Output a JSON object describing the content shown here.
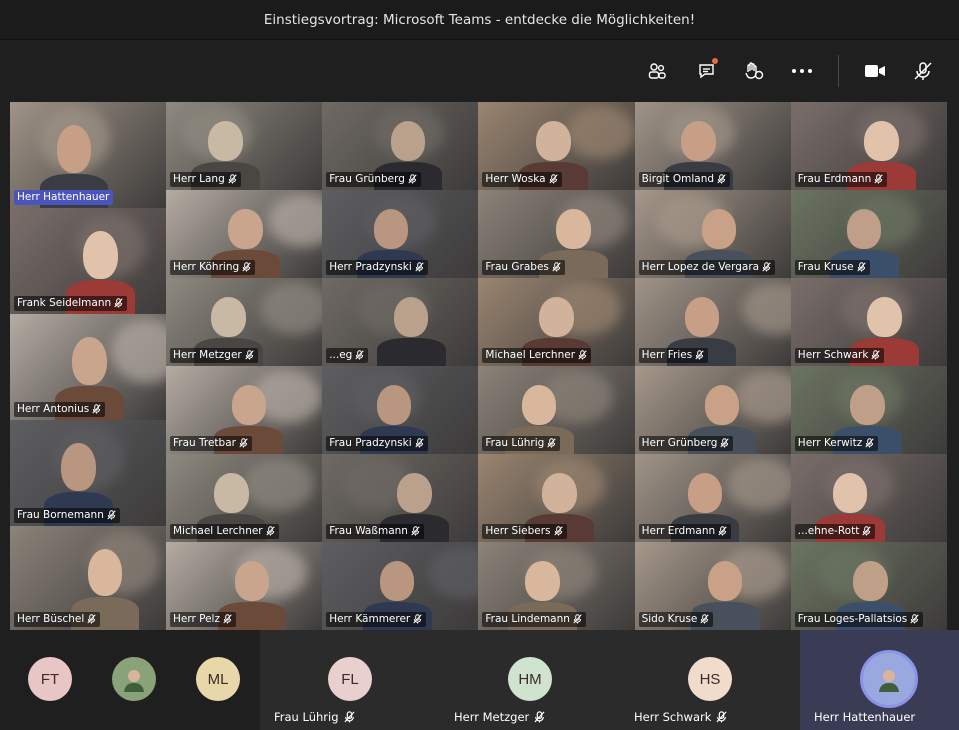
{
  "window": {
    "title": "Einstiegsvortrag: Microsoft Teams - entdecke die Möglichkeiten!"
  },
  "toolbar": {
    "buttons": [
      {
        "icon": "participants-icon"
      },
      {
        "icon": "chat-icon"
      },
      {
        "icon": "reactions-icon"
      },
      {
        "icon": "more-icon"
      },
      {
        "icon": "camera-icon"
      },
      {
        "icon": "mic-muted-icon"
      }
    ],
    "accent": "#e66c3a"
  },
  "stage": {
    "left_column": [
      {
        "name": "Herr Hattenhauer",
        "active": true
      },
      {
        "name": "Frank Seidelmann"
      },
      {
        "name": "Herr Antonius"
      },
      {
        "name": "Frau Bornemann"
      },
      {
        "name": "Herr Büschel"
      }
    ],
    "grid": [
      {
        "name": "Herr Lang"
      },
      {
        "name": "Frau Grünberg"
      },
      {
        "name": "Herr Woska"
      },
      {
        "name": "Birgit Omland"
      },
      {
        "name": "Frau Erdmann"
      },
      {
        "name": "Herr Köhring"
      },
      {
        "name": "Herr Pradzynski"
      },
      {
        "name": "Frau Grabes"
      },
      {
        "name": "Herr Lopez de Vergara"
      },
      {
        "name": "Frau Kruse"
      },
      {
        "name": "Herr Metzger"
      },
      {
        "name": "...eg"
      },
      {
        "name": "Michael Lerchner"
      },
      {
        "name": "Herr Fries"
      },
      {
        "name": "Herr Schwark"
      },
      {
        "name": "Frau Tretbar"
      },
      {
        "name": "Frau Pradzynski"
      },
      {
        "name": "Frau Lührig"
      },
      {
        "name": "Herr Grünberg"
      },
      {
        "name": "Herr Kerwitz"
      },
      {
        "name": "Michael Lerchner"
      },
      {
        "name": "Frau Waßmann"
      },
      {
        "name": "Herr Siebers"
      },
      {
        "name": "Herr Erdmann"
      },
      {
        "name": "...ehne-Rott"
      },
      {
        "name": "Herr Pelz"
      },
      {
        "name": "Herr Kämmerer"
      },
      {
        "name": "Frau Lindemann"
      },
      {
        "name": "Sido Kruse"
      },
      {
        "name": "Frau Loges-Pallatsios"
      }
    ],
    "active_color": "#4b53bc"
  },
  "bottom_bar": {
    "items": [
      {
        "initials": "FT",
        "label": "",
        "color": "#e9c6c6"
      },
      {
        "initials": "",
        "label": "",
        "color": "#8aa27a"
      },
      {
        "initials": "ML",
        "label": "",
        "color": "#e8d7a9"
      },
      {
        "initials": "FL",
        "label": "Frau Lührig",
        "color": "#eacfcf"
      },
      {
        "initials": "HM",
        "label": "Herr Metzger",
        "color": "#cfe3cf"
      },
      {
        "initials": "HS",
        "label": "Herr Schwark",
        "color": "#f1dccb"
      },
      {
        "initials": "",
        "label": "Herr Hattenhauer",
        "color": "#9aa8e0"
      }
    ]
  }
}
